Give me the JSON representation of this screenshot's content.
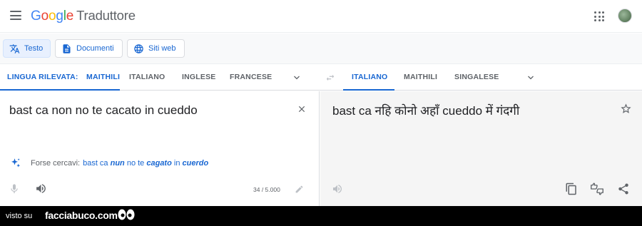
{
  "header": {
    "logo_letters": [
      "G",
      "o",
      "o",
      "g",
      "l",
      "e"
    ],
    "product": "Traduttore",
    "menu_icon": "hamburger-menu-icon",
    "apps_icon": "apps-grid-icon",
    "avatar_icon": "account-avatar"
  },
  "modes": [
    {
      "label": "Testo",
      "icon": "translate-icon",
      "active": true
    },
    {
      "label": "Documenti",
      "icon": "document-icon",
      "active": false
    },
    {
      "label": "Siti web",
      "icon": "globe-icon",
      "active": false
    }
  ],
  "source_langs": {
    "detected": "LINGUA RILEVATA: ",
    "detected_lang": "MAITHILI",
    "items": [
      "ITALIANO",
      "INGLESE",
      "FRANCESE"
    ]
  },
  "target_langs": {
    "items": [
      "ITALIANO",
      "MAITHILI",
      "SINGALESE"
    ]
  },
  "source": {
    "text": "bast ca non no te cacato in cueddo",
    "char_count": "34 / 5.000"
  },
  "suggestion": {
    "prefix": "Forse cercavi:",
    "parts": [
      {
        "text": "bast ca ",
        "emph": false
      },
      {
        "text": "nun",
        "emph": true
      },
      {
        "text": " no te ",
        "emph": false
      },
      {
        "text": "cagato",
        "emph": true
      },
      {
        "text": " in ",
        "emph": false
      },
      {
        "text": "cuerdo",
        "emph": true
      }
    ]
  },
  "target": {
    "text": "bast ca नहि कोनो अहाँ cueddo में गंदगी"
  },
  "footer": {
    "prefix": "visto su",
    "brand": "facciabuco.com"
  },
  "colors": {
    "accent": "#1967d2",
    "icon_gray": "#5f6368"
  }
}
